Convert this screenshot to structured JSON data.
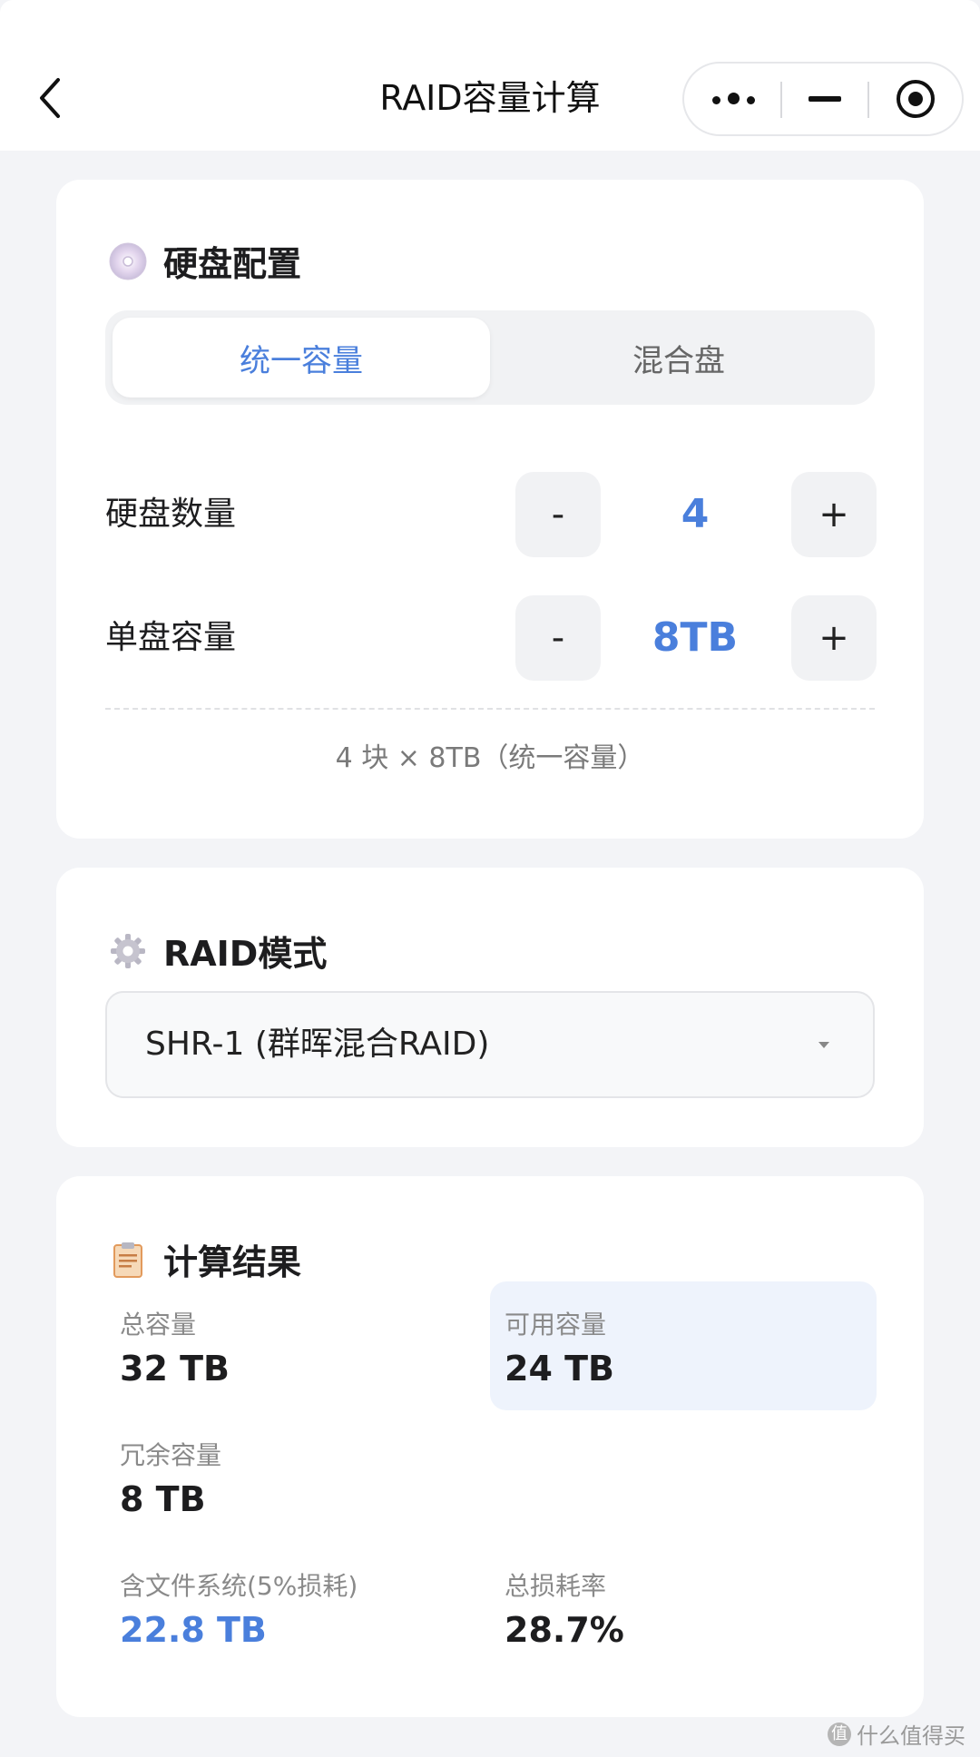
{
  "nav": {
    "title": "RAID容量计算",
    "back_icon": "chevron-left-icon",
    "more_icon": "more-dots-icon",
    "minimize_icon": "minus-icon",
    "close_icon": "target-circle-icon"
  },
  "disk_config": {
    "title": "硬盘配置",
    "icon": "disc-icon",
    "tabs": [
      {
        "label": "统一容量",
        "active": true
      },
      {
        "label": "混合盘",
        "active": false
      }
    ],
    "count": {
      "label": "硬盘数量",
      "minus": "-",
      "value": "4",
      "plus": "+"
    },
    "size": {
      "label": "单盘容量",
      "minus": "-",
      "value": "8TB",
      "plus": "+"
    },
    "summary": "4 块 × 8TB（统一容量）"
  },
  "raid_mode": {
    "title": "RAID模式",
    "icon": "gear-icon",
    "selected": "SHR-1 (群晖混合RAID)"
  },
  "results": {
    "title": "计算结果",
    "icon": "clipboard-icon",
    "total": {
      "label": "总容量",
      "value": "32 TB"
    },
    "usable": {
      "label": "可用容量",
      "value": "24 TB"
    },
    "redundant": {
      "label": "冗余容量",
      "value": "8 TB"
    },
    "fs": {
      "label": "含文件系统(5%损耗)",
      "value": "22.8 TB"
    },
    "loss": {
      "label": "总损耗率",
      "value": "28.7%"
    }
  },
  "watermark": "什么值得买",
  "colors": {
    "accent": "#4a7fdc",
    "background": "#f3f4f7",
    "highlight": "#eef3fc"
  }
}
